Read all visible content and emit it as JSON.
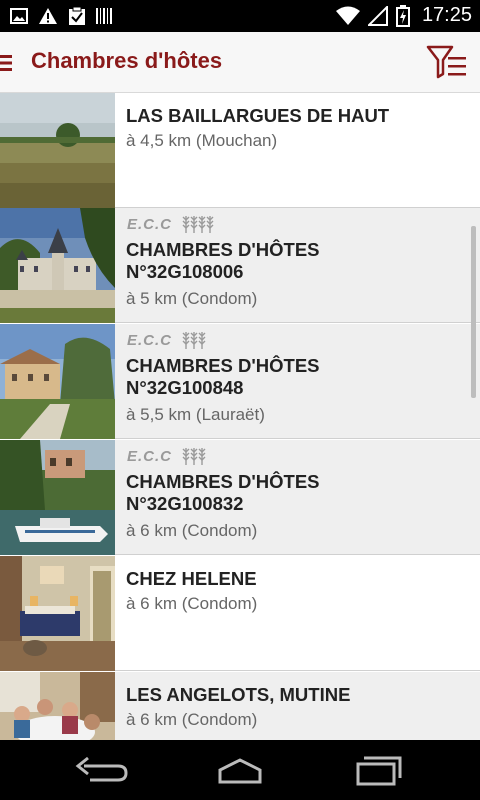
{
  "status_bar": {
    "time": "17:25",
    "icons": [
      "image-icon",
      "warning-icon",
      "clipboard-check-icon",
      "barcode-icon",
      "wifi-icon",
      "signal-icon",
      "battery-icon"
    ]
  },
  "app_bar": {
    "title": "Chambres d'hôtes",
    "menu_icon": "menu-icon",
    "filter_icon": "filter-list-icon"
  },
  "accent_color": "#8a1a1a",
  "listings": [
    {
      "label": "",
      "title_lines": [
        "LAS BAILLARGUES DE HAUT"
      ],
      "distance": "à 4,5 km (Mouchan)",
      "theme": "field"
    },
    {
      "label": "E.C.C",
      "title_lines": [
        "CHAMBRES D'HÔTES",
        "N°32G108006"
      ],
      "distance": "à 5 km (Condom)",
      "theme": "chateau"
    },
    {
      "label": "E.C.C",
      "title_lines": [
        "CHAMBRES D'HÔTES",
        "N°32G100848"
      ],
      "distance": "à 5,5 km (Lauraët)",
      "theme": "farmhouse"
    },
    {
      "label": "E.C.C",
      "title_lines": [
        "CHAMBRES D'HÔTES",
        "N°32G100832"
      ],
      "distance": "à 6 km (Condom)",
      "theme": "boat"
    },
    {
      "label": "",
      "title_lines": [
        "CHEZ HELENE"
      ],
      "distance": "à 6 km (Condom)",
      "theme": "bedroom"
    },
    {
      "label": "",
      "title_lines": [
        "LES ANGELOTS, MUTINE"
      ],
      "distance": "à 6 km (Condom)",
      "theme": "dining"
    }
  ],
  "nav_bar": {
    "icons": [
      "back-icon",
      "home-icon",
      "recent-apps-icon"
    ]
  }
}
